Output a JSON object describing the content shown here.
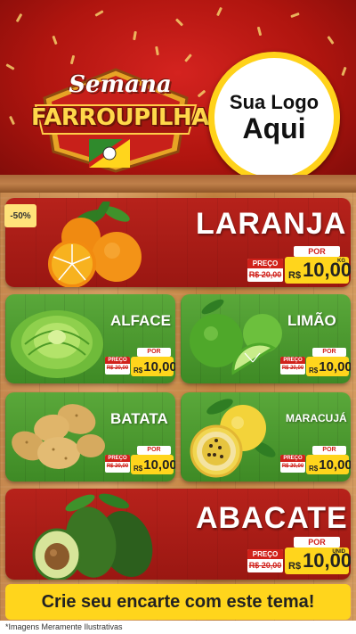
{
  "header": {
    "title_line1": "Semana",
    "title_line2": "FARROUPILHA",
    "logo_line1": "Sua Logo",
    "logo_line2": "Aqui"
  },
  "products": {
    "laranja": {
      "name": "LARANJA",
      "discount": "-50%",
      "por": "POR",
      "preco": "PREÇO",
      "old_price": "R$ 20,00",
      "currency": "R$",
      "price": "10,00",
      "unit": "KG"
    },
    "alface": {
      "name": "ALFACE",
      "por": "POR",
      "preco": "PREÇO",
      "old_price": "R$ 20,00",
      "currency": "R$",
      "price": "10,00"
    },
    "limao": {
      "name": "LIMÃO",
      "por": "POR",
      "preco": "PREÇO",
      "old_price": "R$ 20,00",
      "currency": "R$",
      "price": "10,00"
    },
    "batata": {
      "name": "BATATA",
      "por": "POR",
      "preco": "PREÇO",
      "old_price": "R$ 20,00",
      "currency": "R$",
      "price": "10,00"
    },
    "maracuja": {
      "name": "MARACUJÁ",
      "por": "POR",
      "preco": "PREÇO",
      "old_price": "R$ 20,00",
      "currency": "R$",
      "price": "10,00"
    },
    "abacate": {
      "name": "ABACATE",
      "por": "POR",
      "preco": "PREÇO",
      "old_price": "R$ 20,00",
      "currency": "R$",
      "price": "10,00",
      "unit": "UNID"
    }
  },
  "banner": {
    "text": "Crie seu encarte com este tema!"
  },
  "footnote": "*Imagens Meramente Ilustrativas",
  "colors": {
    "red": "#b7221b",
    "green": "#4e9a30",
    "yellow": "#ffd51c",
    "gold": "#ffd84a"
  }
}
